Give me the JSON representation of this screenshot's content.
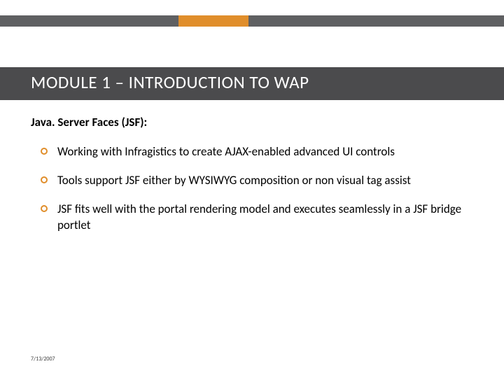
{
  "colors": {
    "accent_orange": "#e08e2b",
    "stripe_gray": "#5f6062",
    "title_bg": "#4b4b4d"
  },
  "header": {
    "title": "MODULE 1 – INTRODUCTION TO WAP"
  },
  "subhead": "Java. Server Faces (JSF):",
  "bullets": [
    "Working with Infragistics to create AJAX-enabled advanced UI controls",
    "Tools support JSF either by WYSIWYG composition or non visual tag assist",
    "JSF fits well with the portal rendering model and executes seamlessly in a JSF bridge portlet"
  ],
  "footer": {
    "date": "7/13/2007"
  }
}
